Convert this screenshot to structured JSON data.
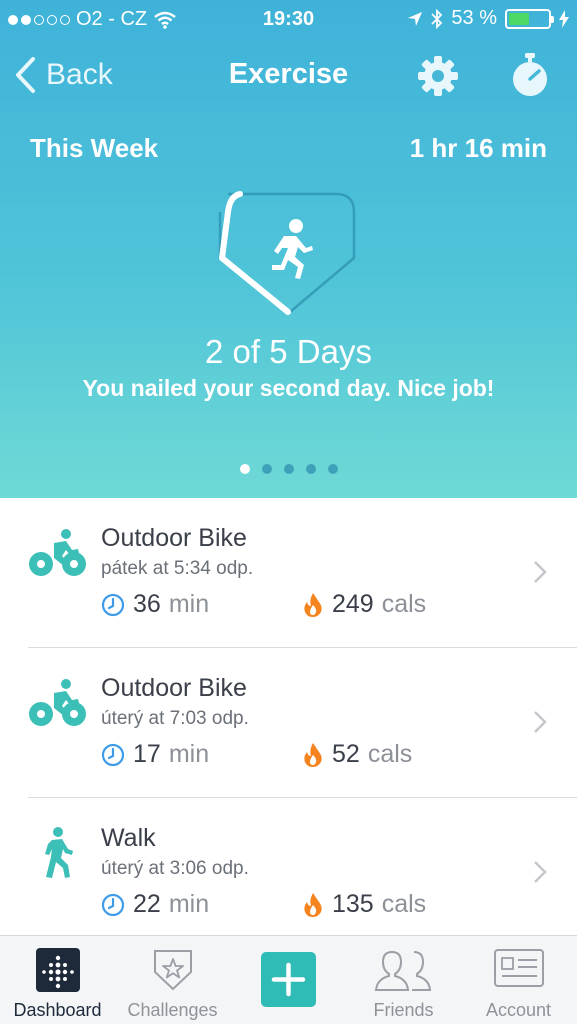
{
  "status_bar": {
    "carrier": "O2 - CZ",
    "time": "19:30",
    "battery": "53 %",
    "battery_level": 0.53
  },
  "nav": {
    "back_label": "Back",
    "title": "Exercise",
    "icons": [
      "settings-gear-icon",
      "stopwatch-icon"
    ]
  },
  "summary": {
    "period_label": "This Week",
    "total_time": "1 hr 16 min",
    "days_text": "2 of 5 Days",
    "days_done": 2,
    "days_goal": 5,
    "message": "You nailed your second day. Nice job!",
    "pager_count": 5,
    "pager_active": 0
  },
  "activities": [
    {
      "icon": "bike-icon",
      "name": "Outdoor Bike",
      "when": "pátek at 5:34 odp.",
      "duration": "36",
      "duration_unit": "min",
      "calories": "249",
      "calories_unit": "cals"
    },
    {
      "icon": "bike-icon",
      "name": "Outdoor Bike",
      "when": "úterý at 7:03 odp.",
      "duration": "17",
      "duration_unit": "min",
      "calories": "52",
      "calories_unit": "cals"
    },
    {
      "icon": "walk-icon",
      "name": "Walk",
      "when": "úterý at 3:06 odp.",
      "duration": "22",
      "duration_unit": "min",
      "calories": "135",
      "calories_unit": "cals"
    }
  ],
  "tabbar": {
    "dashboard": "Dashboard",
    "challenges": "Challenges",
    "friends": "Friends",
    "account": "Account"
  },
  "colors": {
    "accent": "#2fbcb6",
    "hero_top": "#3fb2d9",
    "hero_bottom": "#6fd9d6",
    "clock_blue": "#3d9be9",
    "flame_orange": "#f5841f"
  }
}
